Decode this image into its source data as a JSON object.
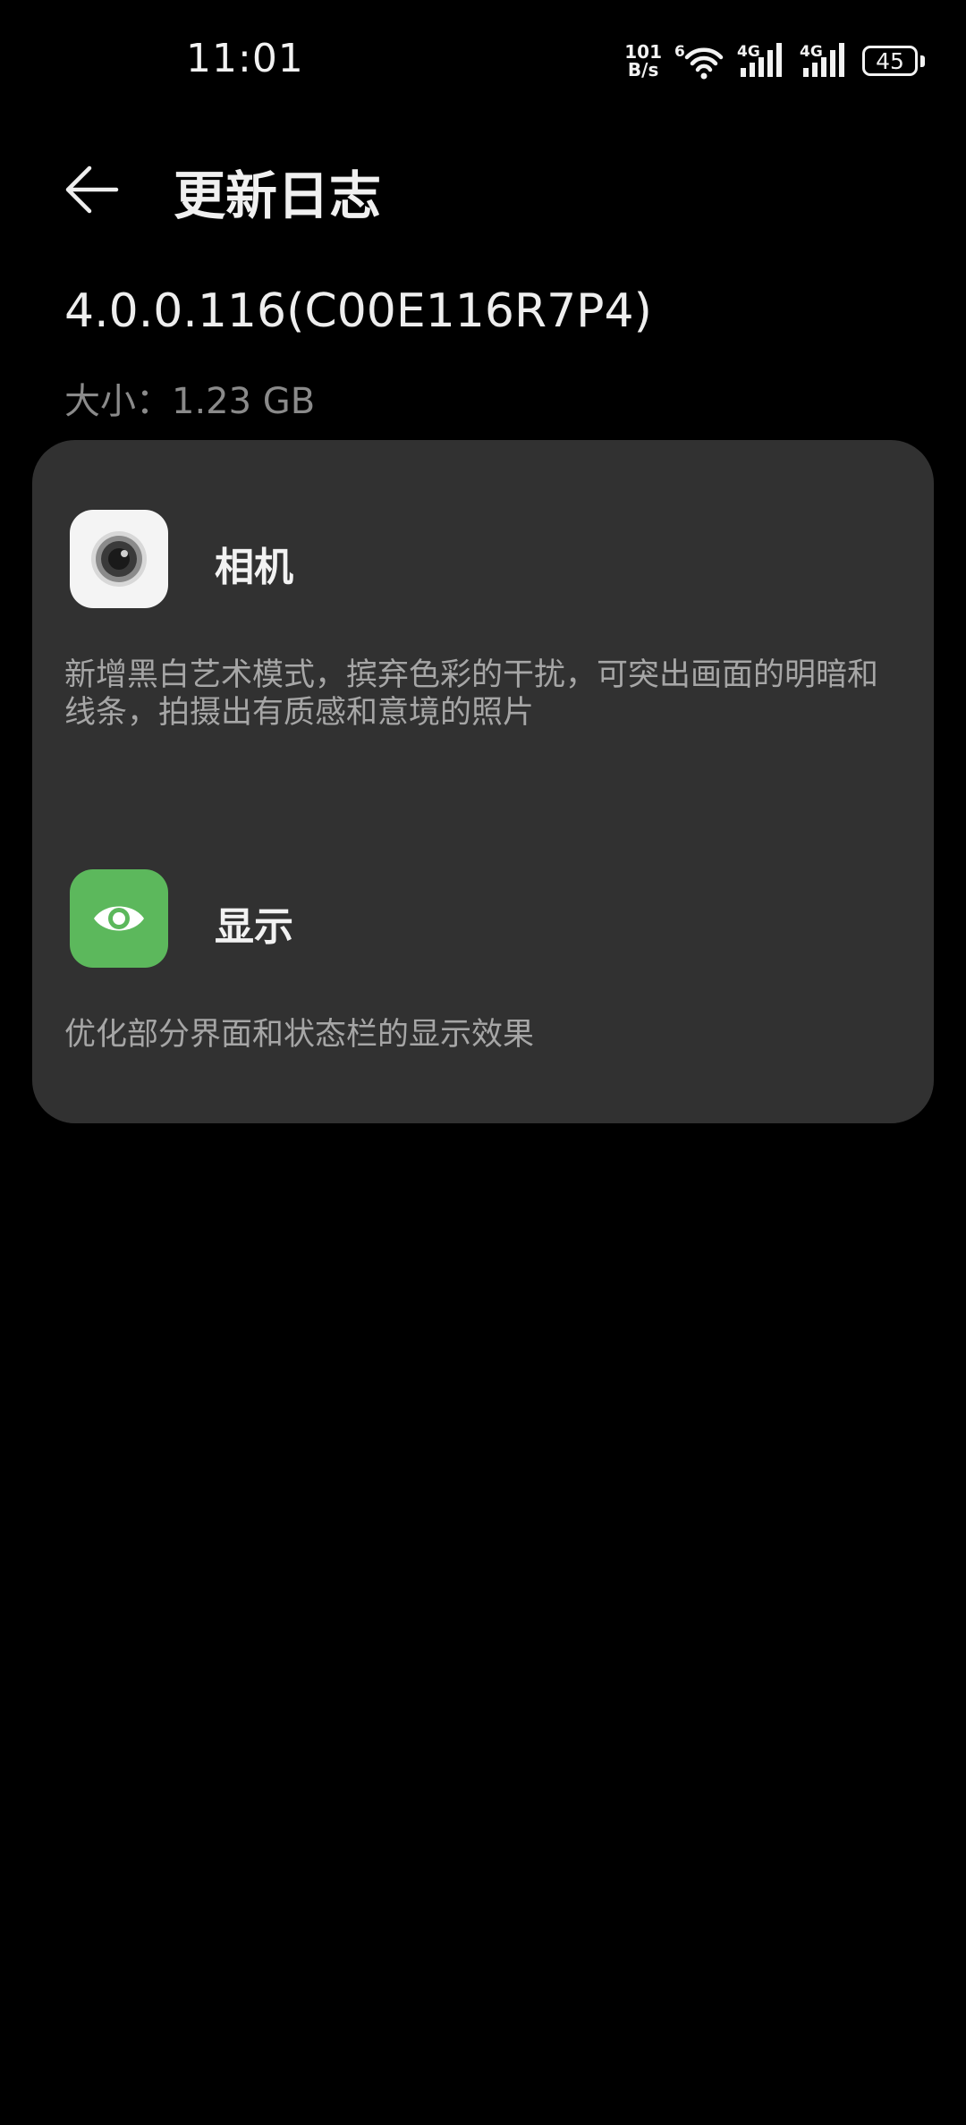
{
  "status_bar": {
    "time": "11:01",
    "net_speed_value": "101",
    "net_speed_unit": "B/s",
    "wifi_label": "6",
    "sim1_label": "4G",
    "sim2_label": "4G",
    "battery": "45"
  },
  "header": {
    "title": "更新日志"
  },
  "update": {
    "version": "4.0.0.116(C00E116R7P4)",
    "size": "大小：1.23 GB"
  },
  "changes": [
    {
      "app": "相机",
      "icon": "camera-icon",
      "description": "新增黑白艺术模式，摈弃色彩的干扰，可突出画面的明暗和线条，拍摄出有质感和意境的照片"
    },
    {
      "app": "显示",
      "icon": "eye-icon",
      "description": "优化部分界面和状态栏的显示效果"
    }
  ],
  "colors": {
    "background": "#000000",
    "card": "#313131",
    "display_icon_green": "#5cb85c"
  }
}
